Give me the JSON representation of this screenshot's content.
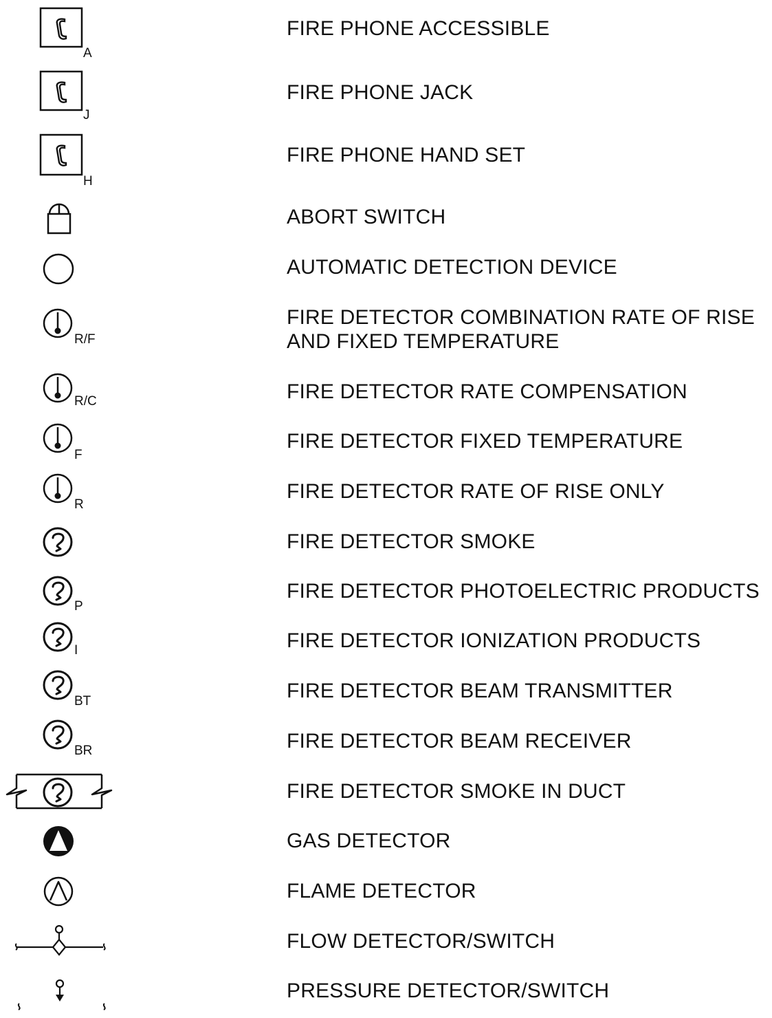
{
  "legend": [
    {
      "symbol": "phone-box",
      "subscript": "A",
      "label": "FIRE PHONE ACCESSIBLE"
    },
    {
      "symbol": "phone-box",
      "subscript": "J",
      "label": "FIRE PHONE JACK"
    },
    {
      "symbol": "phone-box",
      "subscript": "H",
      "label": "FIRE PHONE HAND SET"
    },
    {
      "symbol": "abort-switch",
      "subscript": "",
      "label": "ABORT SWITCH"
    },
    {
      "symbol": "circle",
      "subscript": "",
      "label": "AUTOMATIC DETECTION DEVICE"
    },
    {
      "symbol": "thermometer",
      "subscript": "R/F",
      "label": "FIRE DETECTOR COMBINATION RATE OF RISE",
      "label2": "AND FIXED TEMPERATURE"
    },
    {
      "symbol": "thermometer",
      "subscript": "R/C",
      "label": "FIRE DETECTOR RATE COMPENSATION"
    },
    {
      "symbol": "thermometer",
      "subscript": "F",
      "label": "FIRE DETECTOR FIXED TEMPERATURE"
    },
    {
      "symbol": "thermometer",
      "subscript": "R",
      "label": "FIRE DETECTOR RATE OF RISE ONLY"
    },
    {
      "symbol": "smoke",
      "subscript": "",
      "label": "FIRE DETECTOR SMOKE"
    },
    {
      "symbol": "smoke",
      "subscript": "P",
      "label": "FIRE DETECTOR PHOTOELECTRIC PRODUCTS"
    },
    {
      "symbol": "smoke",
      "subscript": "I",
      "label": "FIRE DETECTOR IONIZATION PRODUCTS"
    },
    {
      "symbol": "smoke",
      "subscript": "BT",
      "label": "FIRE DETECTOR BEAM TRANSMITTER"
    },
    {
      "symbol": "smoke",
      "subscript": "BR",
      "label": "FIRE DETECTOR BEAM RECEIVER"
    },
    {
      "symbol": "smoke-duct",
      "subscript": "",
      "label": "FIRE DETECTOR SMOKE IN DUCT"
    },
    {
      "symbol": "gas",
      "subscript": "",
      "label": "GAS DETECTOR"
    },
    {
      "symbol": "flame",
      "subscript": "",
      "label": "FLAME DETECTOR"
    },
    {
      "symbol": "flow-switch",
      "subscript": "",
      "label": "FLOW DETECTOR/SWITCH"
    },
    {
      "symbol": "pressure-switch",
      "subscript": "",
      "label": "PRESSURE DETECTOR/SWITCH"
    }
  ]
}
